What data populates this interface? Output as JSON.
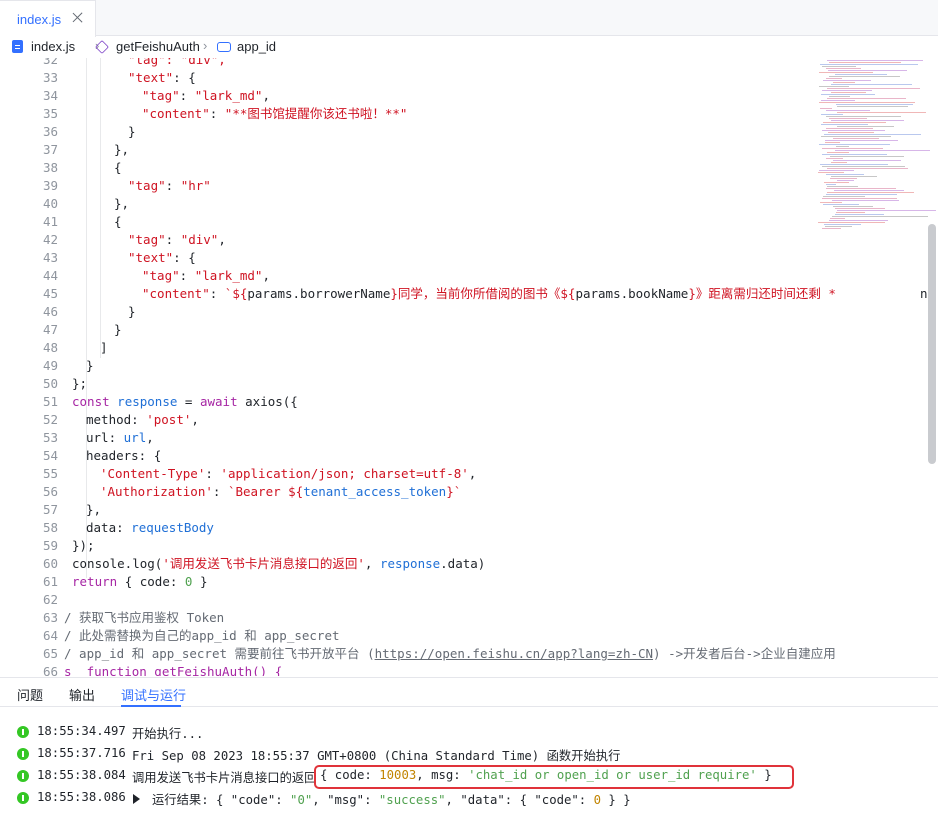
{
  "tab": {
    "label": "index.js"
  },
  "breadcrumb": {
    "file": "index.js",
    "function": "getFeishuAuth",
    "variable": "app_id"
  },
  "gutter": [
    "32",
    "33",
    "34",
    "35",
    "36",
    "37",
    "38",
    "39",
    "40",
    "41",
    "42",
    "43",
    "44",
    "45",
    "46",
    "47",
    "48",
    "49",
    "50",
    "51",
    "52",
    "53",
    "54",
    "55",
    "56",
    "57",
    "58",
    "59",
    "60",
    "61",
    "62",
    "63",
    "64",
    "65",
    "66"
  ],
  "code": {
    "l32": "\"tag\": \"div\",",
    "l33_key": "\"text\"",
    "l33_rest": ": {",
    "l34_key": "\"tag\"",
    "l34_val": "\"lark_md\"",
    "l35_key": "\"content\"",
    "l35_val": "\"**图书馆提醒你该还书啦！**\"",
    "l36": "}",
    "l37": "},",
    "l38": "{",
    "l39_key": "\"tag\"",
    "l39_val": "\"hr\"",
    "l40": "},",
    "l41": "{",
    "l42_key": "\"tag\"",
    "l42_val": "\"div\"",
    "l43_key": "\"text\"",
    "l43_rest": ": {",
    "l44_key": "\"tag\"",
    "l44_val": "\"lark_md\"",
    "l45_key": "\"content\"",
    "l45_a": "`${",
    "l45_b": "params.borrowerName",
    "l45_c": "}同学，当前你所借阅的图书《${",
    "l45_d": "params.bookName",
    "l45_e": "}》距离需归还时间还剩 *",
    "l45_tail": "n",
    "l46": "}",
    "l47": "}",
    "l48": "]",
    "l49": "}",
    "l50": "};",
    "l51_kw": "const",
    "l51_var": "response",
    "l51_aw": "await",
    "l51_fn": "axios({",
    "l52_key": "method",
    "l52_val": "'post'",
    "l53_key": "url",
    "l53_val": "url",
    "l54": "headers: {",
    "l55_key": "'Content-Type'",
    "l55_val": "'application/json; charset=utf-8'",
    "l56_key": "'Authorization'",
    "l56_a": "`Bearer ${",
    "l56_b": "tenant_access_token",
    "l56_c": "}`",
    "l57": "},",
    "l58_key": "data",
    "l58_val": "requestBody",
    "l59": "});",
    "l60_fn": "console.log(",
    "l60_str": "'调用发送飞书卡片消息接口的返回'",
    "l60_var": "response",
    "l60_end": ".data)",
    "l61_kw": "return",
    "l61_a": "{ code: ",
    "l61_n": "0",
    "l61_b": " }",
    "l63": "/ 获取飞书应用鉴权 Token",
    "l64": "/ 此处需替换为自己的app_id 和 app_secret",
    "l65_a": "/ app_id 和 app_secret 需要前往飞书开放平台 (",
    "l65_url": "https://open.feishu.cn/app?lang=zh-CN",
    "l65_b": ") ->开发者后台->企业自建应用 ",
    "l66": "s  function getFeishuAuth() {"
  },
  "panel": {
    "tab1": "问题",
    "tab2": "输出",
    "tab3": "调试与运行"
  },
  "logs": [
    {
      "time": "18:55:34.497",
      "text": "开始执行..."
    },
    {
      "time": "18:55:37.716",
      "text": "Fri Sep 08 2023 18:55:37 GMT+0800 (China Standard Time) 函数开始执行"
    },
    {
      "time": "18:55:38.084",
      "text": "调用发送飞书卡片消息接口的返回",
      "obj_a": "{ code: ",
      "obj_code": "10003",
      "obj_b": ", msg: ",
      "obj_msg": "'chat_id or open_id or user_id require'",
      "obj_c": " }"
    },
    {
      "time": "18:55:38.086",
      "label": "运行结果:",
      "r_a": "{ \"code\": ",
      "r_code": "\"0\"",
      "r_b": ", \"msg\": ",
      "r_msg": "\"success\"",
      "r_c": ", \"data\": { \"code\": ",
      "r_num": "0",
      "r_d": " } }"
    }
  ],
  "colors": {
    "accent": "#3370ff",
    "highlight": "#e0333a",
    "success": "#34c724"
  }
}
